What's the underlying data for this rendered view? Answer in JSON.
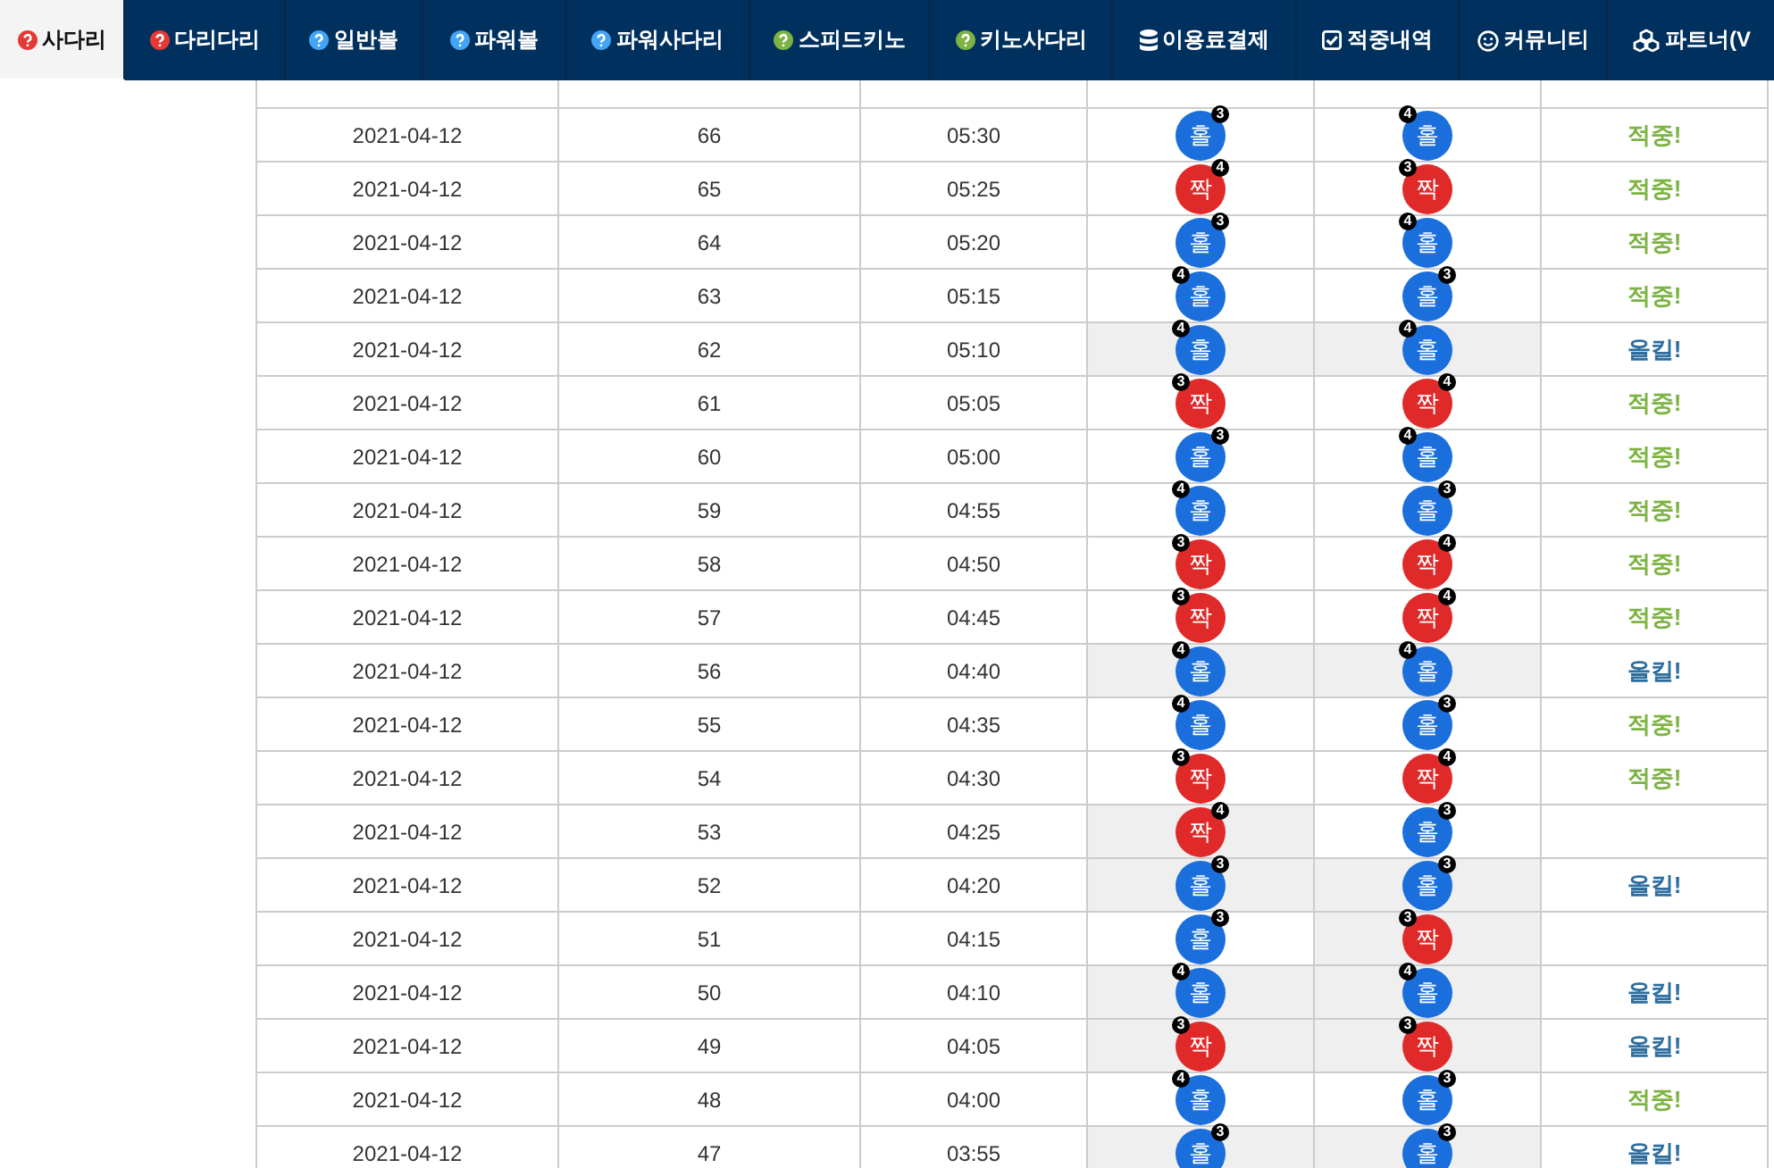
{
  "nav": [
    {
      "label": "사다리",
      "kind": "help",
      "color": "#e53935",
      "selected": true
    },
    {
      "label": "다리다리",
      "kind": "help",
      "color": "#e53935",
      "selected": false
    },
    {
      "label": "일반볼",
      "kind": "help",
      "color": "#42a5f5",
      "selected": false
    },
    {
      "label": "파워볼",
      "kind": "help",
      "color": "#42a5f5",
      "selected": false
    },
    {
      "label": "파워사다리",
      "kind": "help",
      "color": "#42a5f5",
      "selected": false
    },
    {
      "label": "스피드키노",
      "kind": "help",
      "color": "#7cb342",
      "selected": false
    },
    {
      "label": "키노사다리",
      "kind": "help",
      "color": "#7cb342",
      "selected": false
    },
    {
      "label": "이용료결제",
      "kind": "database",
      "selected": false
    },
    {
      "label": "적중내역",
      "kind": "checkbox",
      "selected": false
    },
    {
      "label": "커뮤니티",
      "kind": "smiley",
      "selected": false
    },
    {
      "label": "파트너(V",
      "kind": "cubes",
      "selected": false
    }
  ],
  "rows": [
    {
      "date": "2021-04-12",
      "round": "66",
      "time": "05:30",
      "picks": [
        {
          "kind": "odd",
          "label": "홀",
          "badge": "3",
          "badge_left": false,
          "highlighted": false
        },
        {
          "kind": "odd",
          "label": "홀",
          "badge": "4",
          "badge_left": true,
          "highlighted": false
        }
      ],
      "outcome": {
        "kind": "hit",
        "text": "적중!"
      }
    },
    {
      "date": "2021-04-12",
      "round": "65",
      "time": "05:25",
      "picks": [
        {
          "kind": "even",
          "label": "짝",
          "badge": "4",
          "badge_left": false,
          "highlighted": false
        },
        {
          "kind": "even",
          "label": "짝",
          "badge": "3",
          "badge_left": true,
          "highlighted": false
        }
      ],
      "outcome": {
        "kind": "hit",
        "text": "적중!"
      }
    },
    {
      "date": "2021-04-12",
      "round": "64",
      "time": "05:20",
      "picks": [
        {
          "kind": "odd",
          "label": "홀",
          "badge": "3",
          "badge_left": false,
          "highlighted": false
        },
        {
          "kind": "odd",
          "label": "홀",
          "badge": "4",
          "badge_left": true,
          "highlighted": false
        }
      ],
      "outcome": {
        "kind": "hit",
        "text": "적중!"
      }
    },
    {
      "date": "2021-04-12",
      "round": "63",
      "time": "05:15",
      "picks": [
        {
          "kind": "odd",
          "label": "홀",
          "badge": "4",
          "badge_left": true,
          "highlighted": false
        },
        {
          "kind": "odd",
          "label": "홀",
          "badge": "3",
          "badge_left": false,
          "highlighted": false
        }
      ],
      "outcome": {
        "kind": "hit",
        "text": "적중!"
      }
    },
    {
      "date": "2021-04-12",
      "round": "62",
      "time": "05:10",
      "picks": [
        {
          "kind": "odd",
          "label": "홀",
          "badge": "4",
          "badge_left": true,
          "highlighted": true
        },
        {
          "kind": "odd",
          "label": "홀",
          "badge": "4",
          "badge_left": true,
          "highlighted": true
        }
      ],
      "outcome": {
        "kind": "allkill",
        "text": "올킬!"
      }
    },
    {
      "date": "2021-04-12",
      "round": "61",
      "time": "05:05",
      "picks": [
        {
          "kind": "even",
          "label": "짝",
          "badge": "3",
          "badge_left": true,
          "highlighted": false
        },
        {
          "kind": "even",
          "label": "짝",
          "badge": "4",
          "badge_left": false,
          "highlighted": false
        }
      ],
      "outcome": {
        "kind": "hit",
        "text": "적중!"
      }
    },
    {
      "date": "2021-04-12",
      "round": "60",
      "time": "05:00",
      "picks": [
        {
          "kind": "odd",
          "label": "홀",
          "badge": "3",
          "badge_left": false,
          "highlighted": false
        },
        {
          "kind": "odd",
          "label": "홀",
          "badge": "4",
          "badge_left": true,
          "highlighted": false
        }
      ],
      "outcome": {
        "kind": "hit",
        "text": "적중!"
      }
    },
    {
      "date": "2021-04-12",
      "round": "59",
      "time": "04:55",
      "picks": [
        {
          "kind": "odd",
          "label": "홀",
          "badge": "4",
          "badge_left": true,
          "highlighted": false
        },
        {
          "kind": "odd",
          "label": "홀",
          "badge": "3",
          "badge_left": false,
          "highlighted": false
        }
      ],
      "outcome": {
        "kind": "hit",
        "text": "적중!"
      }
    },
    {
      "date": "2021-04-12",
      "round": "58",
      "time": "04:50",
      "picks": [
        {
          "kind": "even",
          "label": "짝",
          "badge": "3",
          "badge_left": true,
          "highlighted": false
        },
        {
          "kind": "even",
          "label": "짝",
          "badge": "4",
          "badge_left": false,
          "highlighted": false
        }
      ],
      "outcome": {
        "kind": "hit",
        "text": "적중!"
      }
    },
    {
      "date": "2021-04-12",
      "round": "57",
      "time": "04:45",
      "picks": [
        {
          "kind": "even",
          "label": "짝",
          "badge": "3",
          "badge_left": true,
          "highlighted": false
        },
        {
          "kind": "even",
          "label": "짝",
          "badge": "4",
          "badge_left": false,
          "highlighted": false
        }
      ],
      "outcome": {
        "kind": "hit",
        "text": "적중!"
      }
    },
    {
      "date": "2021-04-12",
      "round": "56",
      "time": "04:40",
      "picks": [
        {
          "kind": "odd",
          "label": "홀",
          "badge": "4",
          "badge_left": true,
          "highlighted": true
        },
        {
          "kind": "odd",
          "label": "홀",
          "badge": "4",
          "badge_left": true,
          "highlighted": true
        }
      ],
      "outcome": {
        "kind": "allkill",
        "text": "올킬!"
      }
    },
    {
      "date": "2021-04-12",
      "round": "55",
      "time": "04:35",
      "picks": [
        {
          "kind": "odd",
          "label": "홀",
          "badge": "4",
          "badge_left": true,
          "highlighted": false
        },
        {
          "kind": "odd",
          "label": "홀",
          "badge": "3",
          "badge_left": false,
          "highlighted": false
        }
      ],
      "outcome": {
        "kind": "hit",
        "text": "적중!"
      }
    },
    {
      "date": "2021-04-12",
      "round": "54",
      "time": "04:30",
      "picks": [
        {
          "kind": "even",
          "label": "짝",
          "badge": "3",
          "badge_left": true,
          "highlighted": false
        },
        {
          "kind": "even",
          "label": "짝",
          "badge": "4",
          "badge_left": false,
          "highlighted": false
        }
      ],
      "outcome": {
        "kind": "hit",
        "text": "적중!"
      }
    },
    {
      "date": "2021-04-12",
      "round": "53",
      "time": "04:25",
      "picks": [
        {
          "kind": "even",
          "label": "짝",
          "badge": "4",
          "badge_left": false,
          "highlighted": true
        },
        {
          "kind": "odd",
          "label": "홀",
          "badge": "3",
          "badge_left": false,
          "highlighted": false
        }
      ]
    },
    {
      "date": "2021-04-12",
      "round": "52",
      "time": "04:20",
      "picks": [
        {
          "kind": "odd",
          "label": "홀",
          "badge": "3",
          "badge_left": false,
          "highlighted": true
        },
        {
          "kind": "odd",
          "label": "홀",
          "badge": "3",
          "badge_left": false,
          "highlighted": true
        }
      ],
      "outcome": {
        "kind": "allkill",
        "text": "올킬!"
      }
    },
    {
      "date": "2021-04-12",
      "round": "51",
      "time": "04:15",
      "picks": [
        {
          "kind": "odd",
          "label": "홀",
          "badge": "3",
          "badge_left": false,
          "highlighted": false
        },
        {
          "kind": "even",
          "label": "짝",
          "badge": "3",
          "badge_left": true,
          "highlighted": true
        }
      ]
    },
    {
      "date": "2021-04-12",
      "round": "50",
      "time": "04:10",
      "picks": [
        {
          "kind": "odd",
          "label": "홀",
          "badge": "4",
          "badge_left": true,
          "highlighted": true
        },
        {
          "kind": "odd",
          "label": "홀",
          "badge": "4",
          "badge_left": true,
          "highlighted": true
        }
      ],
      "outcome": {
        "kind": "allkill",
        "text": "올킬!"
      }
    },
    {
      "date": "2021-04-12",
      "round": "49",
      "time": "04:05",
      "picks": [
        {
          "kind": "even",
          "label": "짝",
          "badge": "3",
          "badge_left": true,
          "highlighted": true
        },
        {
          "kind": "even",
          "label": "짝",
          "badge": "3",
          "badge_left": true,
          "highlighted": true
        }
      ],
      "outcome": {
        "kind": "allkill",
        "text": "올킬!"
      }
    },
    {
      "date": "2021-04-12",
      "round": "48",
      "time": "04:00",
      "picks": [
        {
          "kind": "odd",
          "label": "홀",
          "badge": "4",
          "badge_left": true,
          "highlighted": false
        },
        {
          "kind": "odd",
          "label": "홀",
          "badge": "3",
          "badge_left": false,
          "highlighted": false
        }
      ],
      "outcome": {
        "kind": "hit",
        "text": "적중!"
      }
    },
    {
      "date": "2021-04-12",
      "round": "47",
      "time": "03:55",
      "picks": [
        {
          "kind": "odd",
          "label": "홀",
          "badge": "3",
          "badge_left": false,
          "highlighted": true
        },
        {
          "kind": "odd",
          "label": "홀",
          "badge": "3",
          "badge_left": false,
          "highlighted": true
        }
      ],
      "outcome": {
        "kind": "allkill",
        "text": "올킬!"
      }
    }
  ]
}
